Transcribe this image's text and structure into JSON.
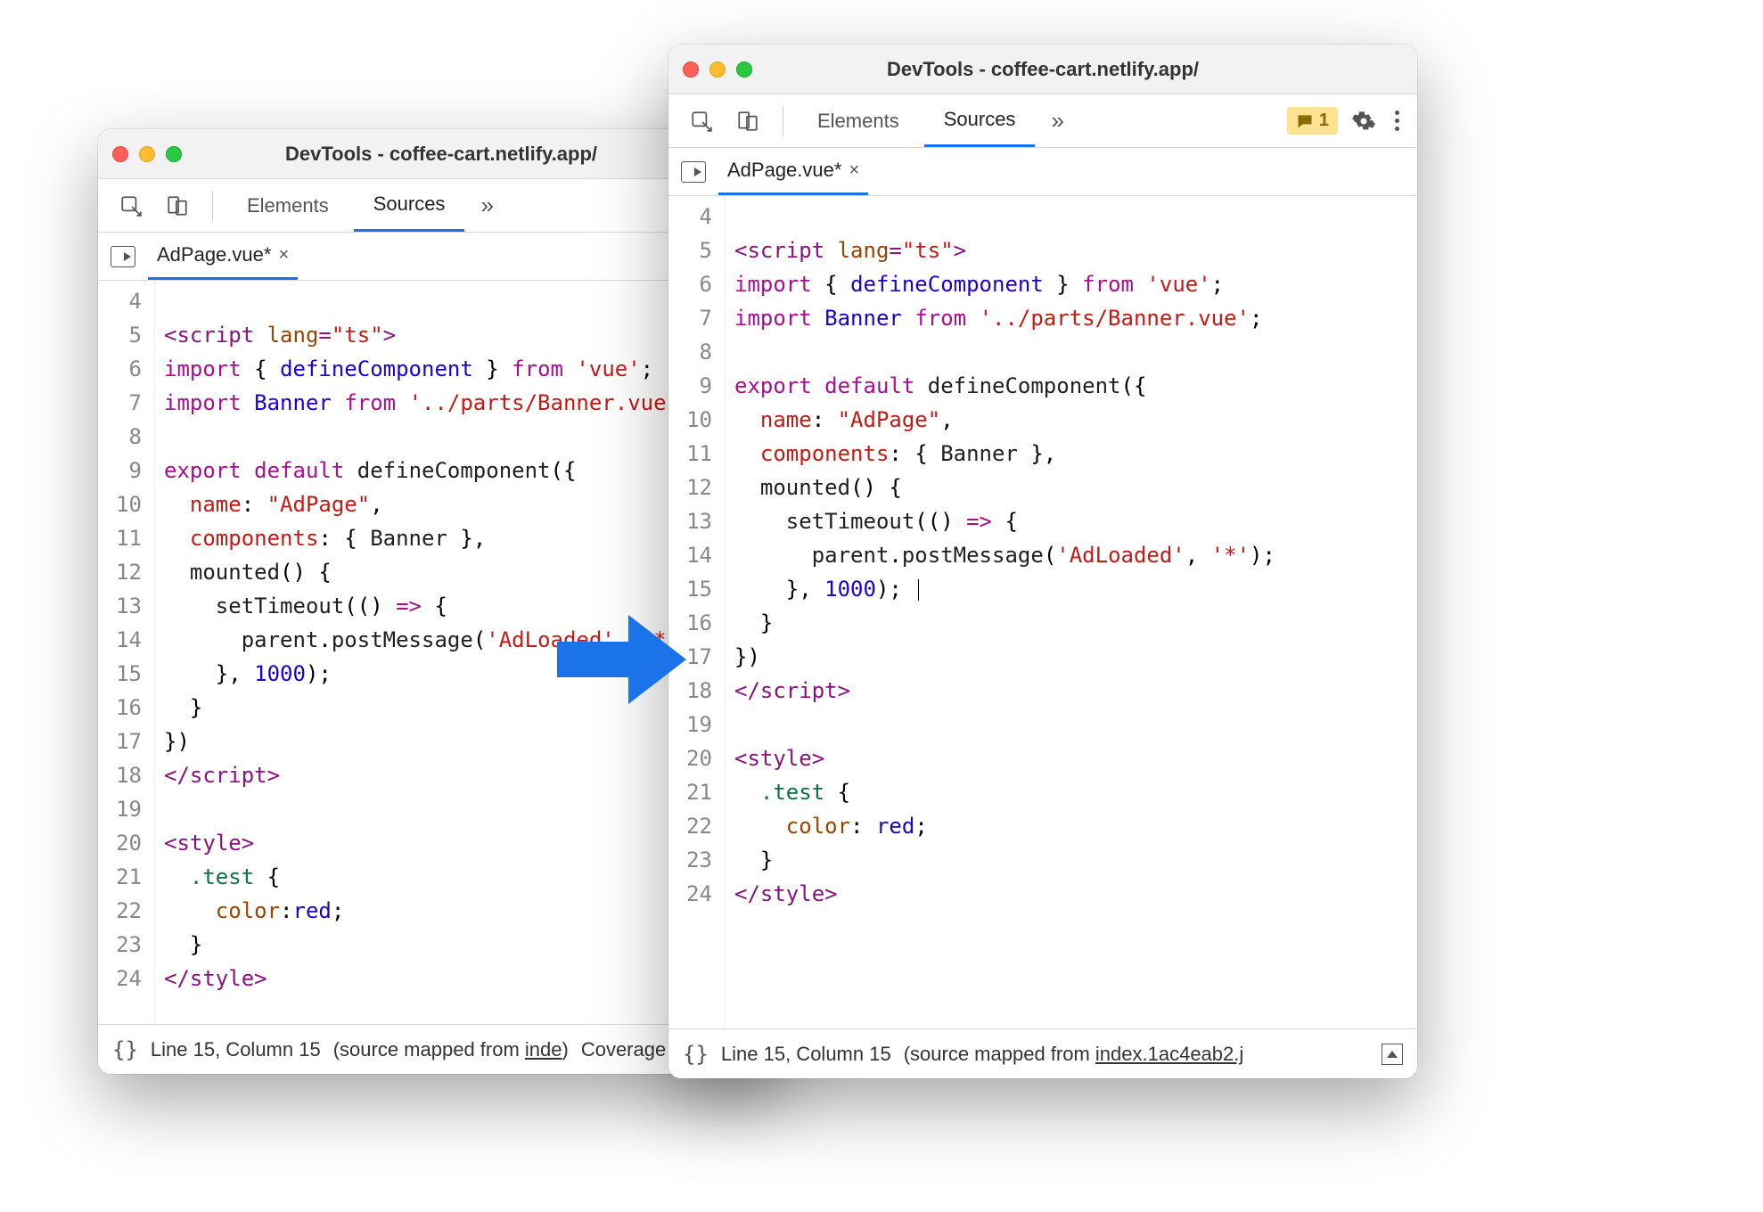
{
  "shared": {
    "title": "DevTools - coffee-cart.netlify.app/",
    "tabs": {
      "elements": "Elements",
      "sources": "Sources"
    },
    "filetab": "AdPage.vue*",
    "statusbar_location": "Line 15, Column 15",
    "statusbar_mapped_prefix": "(source mapped from ",
    "alert_count": "1"
  },
  "win1": {
    "statusbar_mapped_file": "inde",
    "statusbar_extra": "Coverage",
    "lines": [
      {
        "n": "4",
        "segs": []
      },
      {
        "n": "5",
        "segs": [
          [
            "t-tag",
            "<script "
          ],
          [
            "t-attr",
            "lang"
          ],
          [
            "t-tag",
            "="
          ],
          [
            "t-str",
            "\"ts\""
          ],
          [
            "t-tag",
            ">"
          ]
        ]
      },
      {
        "n": "6",
        "segs": [
          [
            "t-kw",
            "import"
          ],
          [
            "t-punc",
            " { "
          ],
          [
            "t-def",
            "defineComponent"
          ],
          [
            "t-punc",
            " } "
          ],
          [
            "t-kw",
            "from"
          ],
          [
            "t-punc",
            " "
          ],
          [
            "t-str",
            "'vue'"
          ],
          [
            "t-punc",
            ";"
          ]
        ]
      },
      {
        "n": "7",
        "segs": [
          [
            "t-kw",
            "import"
          ],
          [
            "t-punc",
            " "
          ],
          [
            "t-def",
            "Banner"
          ],
          [
            "t-punc",
            " "
          ],
          [
            "t-kw",
            "from"
          ],
          [
            "t-punc",
            " "
          ],
          [
            "t-str",
            "'../parts/Banner.vue"
          ]
        ]
      },
      {
        "n": "8",
        "segs": []
      },
      {
        "n": "9",
        "segs": [
          [
            "t-kw",
            "export"
          ],
          [
            "t-punc",
            " "
          ],
          [
            "t-kw",
            "default"
          ],
          [
            "t-punc",
            " "
          ],
          [
            "t-id",
            "defineComponent"
          ],
          [
            "t-punc",
            "({"
          ]
        ]
      },
      {
        "n": "10",
        "segs": [
          [
            "t-punc",
            "  "
          ],
          [
            "t-prop",
            "name"
          ],
          [
            "t-punc",
            ": "
          ],
          [
            "t-str",
            "\"AdPage\""
          ],
          [
            "t-punc",
            ","
          ]
        ]
      },
      {
        "n": "11",
        "segs": [
          [
            "t-punc",
            "  "
          ],
          [
            "t-prop",
            "components"
          ],
          [
            "t-punc",
            ": { "
          ],
          [
            "t-id",
            "Banner"
          ],
          [
            "t-punc",
            " },"
          ]
        ]
      },
      {
        "n": "12",
        "segs": [
          [
            "t-punc",
            "  "
          ],
          [
            "t-id",
            "mounted"
          ],
          [
            "t-punc",
            "() {"
          ]
        ]
      },
      {
        "n": "13",
        "segs": [
          [
            "t-punc",
            "    "
          ],
          [
            "t-id",
            "setTimeout"
          ],
          [
            "t-punc",
            "(() "
          ],
          [
            "t-kw",
            "=>"
          ],
          [
            "t-punc",
            " {"
          ]
        ]
      },
      {
        "n": "14",
        "segs": [
          [
            "t-punc",
            "      "
          ],
          [
            "t-id",
            "parent"
          ],
          [
            "t-punc",
            "."
          ],
          [
            "t-id",
            "postMessage"
          ],
          [
            "t-punc",
            "("
          ],
          [
            "t-str",
            "'AdLoaded'"
          ],
          [
            "t-punc",
            ", "
          ],
          [
            "t-str",
            "'*"
          ]
        ]
      },
      {
        "n": "15",
        "segs": [
          [
            "t-punc",
            "    }, "
          ],
          [
            "t-num",
            "1000"
          ],
          [
            "t-punc",
            ");"
          ]
        ]
      },
      {
        "n": "16",
        "segs": [
          [
            "t-punc",
            "  }"
          ]
        ]
      },
      {
        "n": "17",
        "segs": [
          [
            "t-punc",
            "})"
          ]
        ]
      },
      {
        "n": "18",
        "segs": [
          [
            "t-tag",
            "</"
          ],
          [
            "t-tag",
            "script"
          ],
          [
            "t-tag",
            ">"
          ]
        ]
      },
      {
        "n": "19",
        "segs": []
      },
      {
        "n": "20",
        "segs": [
          [
            "t-tag",
            "<style>"
          ]
        ]
      },
      {
        "n": "21",
        "segs": [
          [
            "t-punc",
            "  "
          ],
          [
            "t-css-sel",
            ".test"
          ],
          [
            "t-punc",
            " {"
          ]
        ]
      },
      {
        "n": "22",
        "segs": [
          [
            "t-punc",
            "    "
          ],
          [
            "t-css-prop",
            "color"
          ],
          [
            "t-punc",
            ":"
          ],
          [
            "t-css-val",
            "red"
          ],
          [
            "t-punc",
            ";"
          ]
        ]
      },
      {
        "n": "23",
        "segs": [
          [
            "t-punc",
            "  }"
          ]
        ]
      },
      {
        "n": "24",
        "segs": [
          [
            "t-tag",
            "</style>"
          ]
        ]
      }
    ]
  },
  "win2": {
    "statusbar_mapped_file": "index.1ac4eab2.j",
    "lines": [
      {
        "n": "4",
        "segs": []
      },
      {
        "n": "5",
        "segs": [
          [
            "t-tag",
            "<script "
          ],
          [
            "t-attr",
            "lang"
          ],
          [
            "t-tag",
            "="
          ],
          [
            "t-str",
            "\"ts\""
          ],
          [
            "t-tag",
            ">"
          ]
        ]
      },
      {
        "n": "6",
        "segs": [
          [
            "t-kw",
            "import"
          ],
          [
            "t-punc",
            " { "
          ],
          [
            "t-def",
            "defineComponent"
          ],
          [
            "t-punc",
            " } "
          ],
          [
            "t-kw",
            "from"
          ],
          [
            "t-punc",
            " "
          ],
          [
            "t-str",
            "'vue'"
          ],
          [
            "t-punc",
            ";"
          ]
        ]
      },
      {
        "n": "7",
        "segs": [
          [
            "t-kw",
            "import"
          ],
          [
            "t-punc",
            " "
          ],
          [
            "t-def",
            "Banner"
          ],
          [
            "t-punc",
            " "
          ],
          [
            "t-kw",
            "from"
          ],
          [
            "t-punc",
            " "
          ],
          [
            "t-str",
            "'../parts/Banner.vue'"
          ],
          [
            "t-punc",
            ";"
          ]
        ]
      },
      {
        "n": "8",
        "segs": []
      },
      {
        "n": "9",
        "segs": [
          [
            "t-kw",
            "export"
          ],
          [
            "t-punc",
            " "
          ],
          [
            "t-kw",
            "default"
          ],
          [
            "t-punc",
            " "
          ],
          [
            "t-id",
            "defineComponent"
          ],
          [
            "t-punc",
            "({"
          ]
        ]
      },
      {
        "n": "10",
        "segs": [
          [
            "t-punc",
            "  "
          ],
          [
            "t-prop",
            "name"
          ],
          [
            "t-punc",
            ": "
          ],
          [
            "t-str",
            "\"AdPage\""
          ],
          [
            "t-punc",
            ","
          ]
        ]
      },
      {
        "n": "11",
        "segs": [
          [
            "t-punc",
            "  "
          ],
          [
            "t-prop",
            "components"
          ],
          [
            "t-punc",
            ": { "
          ],
          [
            "t-id",
            "Banner"
          ],
          [
            "t-punc",
            " },"
          ]
        ]
      },
      {
        "n": "12",
        "segs": [
          [
            "t-punc",
            "  "
          ],
          [
            "t-id",
            "mounted"
          ],
          [
            "t-punc",
            "() {"
          ]
        ]
      },
      {
        "n": "13",
        "segs": [
          [
            "t-punc",
            "    "
          ],
          [
            "t-id",
            "setTimeout"
          ],
          [
            "t-punc",
            "(() "
          ],
          [
            "t-kw",
            "=>"
          ],
          [
            "t-punc",
            " {"
          ]
        ]
      },
      {
        "n": "14",
        "segs": [
          [
            "t-punc",
            "      "
          ],
          [
            "t-id",
            "parent"
          ],
          [
            "t-punc",
            "."
          ],
          [
            "t-id",
            "postMessage"
          ],
          [
            "t-punc",
            "("
          ],
          [
            "t-str",
            "'AdLoaded'"
          ],
          [
            "t-punc",
            ", "
          ],
          [
            "t-str",
            "'*'"
          ],
          [
            "t-punc",
            ");"
          ]
        ]
      },
      {
        "n": "15",
        "segs": [
          [
            "t-punc",
            "    }, "
          ],
          [
            "t-num",
            "1000"
          ],
          [
            "t-punc",
            "); "
          ],
          [
            "cursor",
            "|"
          ]
        ]
      },
      {
        "n": "16",
        "segs": [
          [
            "t-punc",
            "  }"
          ]
        ]
      },
      {
        "n": "17",
        "segs": [
          [
            "t-punc",
            "})"
          ]
        ]
      },
      {
        "n": "18",
        "segs": [
          [
            "t-tag",
            "</"
          ],
          [
            "t-tag",
            "script"
          ],
          [
            "t-tag",
            ">"
          ]
        ]
      },
      {
        "n": "19",
        "segs": []
      },
      {
        "n": "20",
        "segs": [
          [
            "t-tag",
            "<style>"
          ]
        ]
      },
      {
        "n": "21",
        "segs": [
          [
            "t-punc",
            "  "
          ],
          [
            "t-css-sel",
            ".test"
          ],
          [
            "t-punc",
            " {"
          ]
        ]
      },
      {
        "n": "22",
        "segs": [
          [
            "t-punc",
            "    "
          ],
          [
            "t-css-prop",
            "color"
          ],
          [
            "t-punc",
            ": "
          ],
          [
            "t-css-val",
            "red"
          ],
          [
            "t-punc",
            ";"
          ]
        ]
      },
      {
        "n": "23",
        "segs": [
          [
            "t-punc",
            "  }"
          ]
        ]
      },
      {
        "n": "24",
        "segs": [
          [
            "t-tag",
            "</style>"
          ]
        ]
      }
    ]
  }
}
